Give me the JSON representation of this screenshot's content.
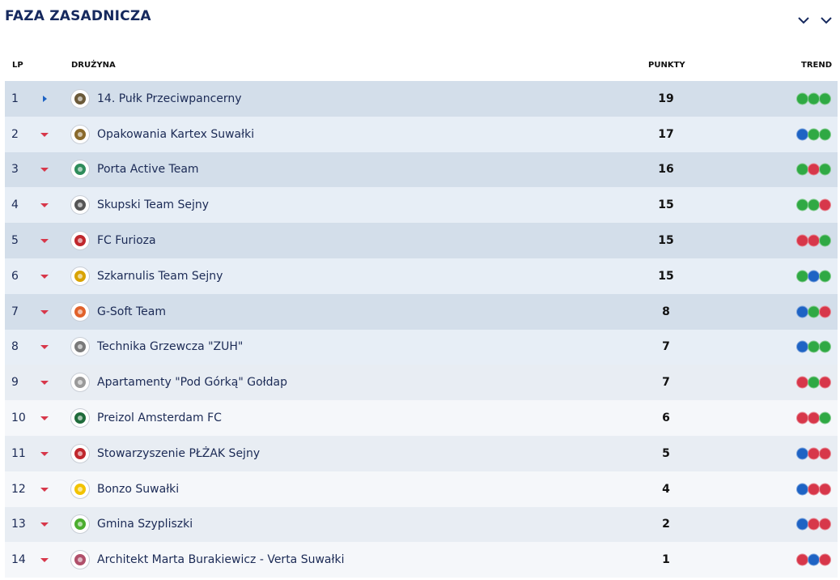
{
  "section": {
    "title": "FAZA ZASADNICZA"
  },
  "columns": {
    "lp": "LP",
    "team": "DRUŻYNA",
    "points": "PUNKTY",
    "trend": "TREND"
  },
  "colors": {
    "W": "#2fa944",
    "D": "#1e63c4",
    "L": "#d7374a",
    "arrow_up": "#1e63c4",
    "arrow_down": "#d7374a"
  },
  "rows": [
    {
      "lp": "1",
      "team": "14. Pułk Przeciwpancerny",
      "points": "19",
      "movement": "right",
      "logo": "#6b5a3a",
      "trend": [
        "W",
        "W",
        "W"
      ]
    },
    {
      "lp": "2",
      "team": "Opakowania Kartex Suwałki",
      "points": "17",
      "movement": "down",
      "logo": "#8a6a2c",
      "trend": [
        "D",
        "W",
        "W"
      ]
    },
    {
      "lp": "3",
      "team": "Porta Active Team",
      "points": "16",
      "movement": "down",
      "logo": "#2f8c5b",
      "trend": [
        "W",
        "L",
        "W"
      ]
    },
    {
      "lp": "4",
      "team": "Skupski Team Sejny",
      "points": "15",
      "movement": "down",
      "logo": "#555555",
      "trend": [
        "W",
        "W",
        "L"
      ]
    },
    {
      "lp": "5",
      "team": "FC Furioza",
      "points": "15",
      "movement": "down",
      "logo": "#c0272d",
      "trend": [
        "L",
        "L",
        "W"
      ]
    },
    {
      "lp": "6",
      "team": "Szkarnulis Team Sejny",
      "points": "15",
      "movement": "down",
      "logo": "#d9a300",
      "trend": [
        "W",
        "D",
        "W"
      ]
    },
    {
      "lp": "7",
      "team": "G-Soft Team",
      "points": "8",
      "movement": "down",
      "logo": "#e1622b",
      "trend": [
        "D",
        "W",
        "L"
      ]
    },
    {
      "lp": "8",
      "team": "Technika Grzewcza \"ZUH\"",
      "points": "7",
      "movement": "down",
      "logo": "#7a7a7a",
      "trend": [
        "D",
        "W",
        "W"
      ]
    },
    {
      "lp": "9",
      "team": "Apartamenty \"Pod Górką\" Gołdap",
      "points": "7",
      "movement": "down",
      "logo": "#9a9a9a",
      "trend": [
        "L",
        "W",
        "L"
      ]
    },
    {
      "lp": "10",
      "team": "Preizol Amsterdam FC",
      "points": "6",
      "movement": "down",
      "logo": "#1f6b3b",
      "trend": [
        "L",
        "L",
        "W"
      ]
    },
    {
      "lp": "11",
      "team": "Stowarzyszenie PŁŻAK Sejny",
      "points": "5",
      "movement": "down",
      "logo": "#c0272d",
      "trend": [
        "D",
        "L",
        "L"
      ]
    },
    {
      "lp": "12",
      "team": "Bonzo Suwałki",
      "points": "4",
      "movement": "down",
      "logo": "#f2c300",
      "trend": [
        "D",
        "L",
        "L"
      ]
    },
    {
      "lp": "13",
      "team": "Gmina Szypliszki",
      "points": "2",
      "movement": "down",
      "logo": "#4cae2f",
      "trend": [
        "D",
        "L",
        "L"
      ]
    },
    {
      "lp": "14",
      "team": "Architekt Marta Burakiewicz - Verta Suwałki",
      "points": "1",
      "movement": "down",
      "logo": "#b0506b",
      "trend": [
        "L",
        "D",
        "L"
      ]
    }
  ]
}
